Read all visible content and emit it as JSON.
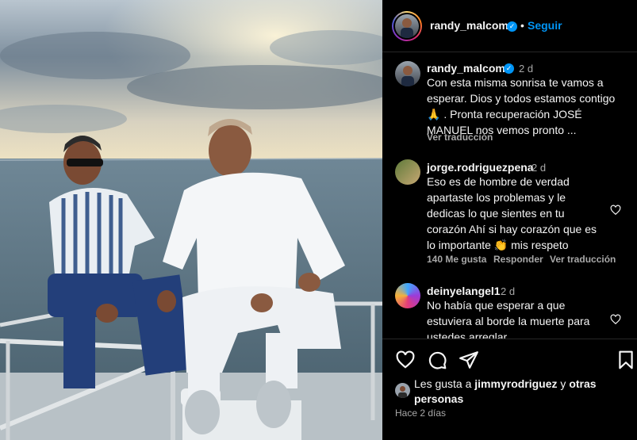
{
  "post": {
    "author": "randy_malcom",
    "separator": "•",
    "follow_label": "Seguir"
  },
  "comments": [
    {
      "user": "randy_malcom",
      "time": "2 d",
      "verified": true,
      "lines": [
        "Con esta misma sonrisa te vamos a",
        "esperar. Dios y todos estamos contigo",
        "🙏 . Pronta recuperación JOSÉ",
        "MANUEL nos vemos pronto ..."
      ],
      "translate": "Ver traducción"
    },
    {
      "user": "jorge.rodriguezpena",
      "time": "2 d",
      "lines": [
        "Eso es de hombre de verdad",
        "apartaste los problemas y le",
        "dedicas lo que sientes en tu",
        "corazón Ahí si hay corazón que es",
        "lo importante 👏 mis respeto"
      ],
      "likes": "140 Me gusta",
      "reply": "Responder",
      "translate": "Ver traducción"
    },
    {
      "user": "deinyelangel1",
      "time": "2 d",
      "lines": [
        "No había que esperar a que",
        "estuviera al borde la muerte para",
        "ustedes arreglar"
      ]
    }
  ],
  "likes": {
    "prefix": "Les gusta a ",
    "user": "jimmyrodriguez",
    "middle": " y ",
    "others": "otras",
    "others2": "personas"
  },
  "date": "Hace 2 días",
  "colors": {
    "accent": "#0095f6",
    "muted": "#a8a8a8",
    "background": "#000000"
  },
  "icons": [
    "heart-icon",
    "comment-icon",
    "share-icon",
    "bookmark-icon",
    "verified-icon"
  ]
}
